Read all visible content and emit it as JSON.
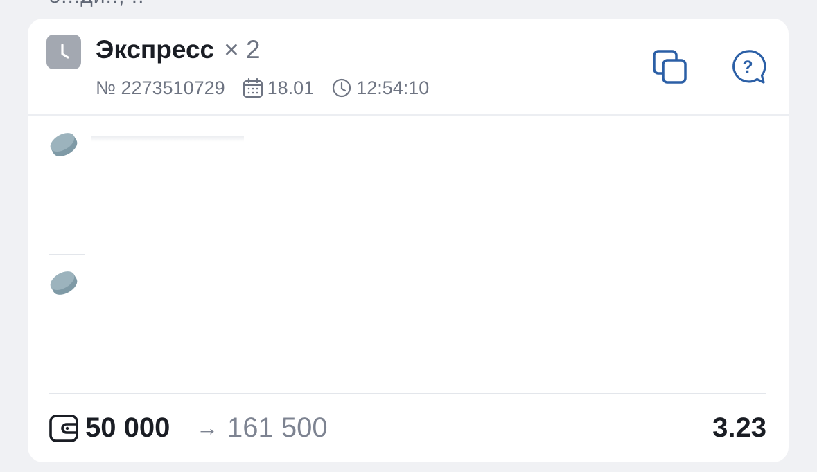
{
  "top_fragment": "б...ди.., ..",
  "bet": {
    "title": "Экспресс",
    "multiplier": "× 2",
    "number": "№ 2273510729",
    "date": "18.01",
    "time": "12:54:10",
    "type_icon": "clock-icon",
    "actions": {
      "copy_icon": "copy-icon",
      "help_icon": "help-bubble-icon"
    }
  },
  "events": [
    {
      "sport_icon": "hockey-puck-icon"
    },
    {
      "sport_icon": "hockey-puck-icon"
    }
  ],
  "footer": {
    "stake": "50 000",
    "arrow": "→",
    "payout": "161 500",
    "coefficient": "3.23"
  },
  "colors": {
    "accent_blue": "#2b5fa6",
    "puck": "#7f9aa6",
    "badge_gray": "#a3a8b1"
  }
}
